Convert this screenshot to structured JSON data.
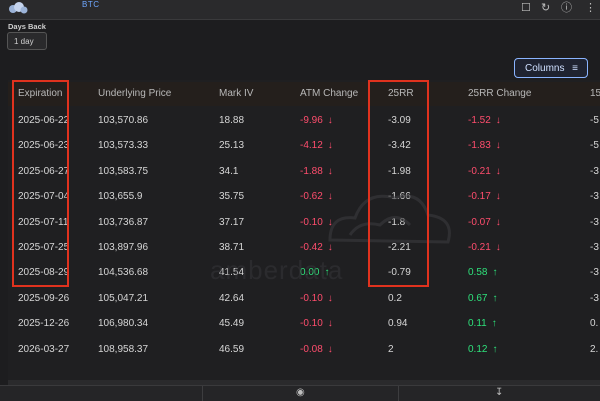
{
  "topbar": {
    "ticker": "BTC",
    "icons": [
      "bookmark-icon",
      "refresh-icon",
      "info-icon",
      "more-icon"
    ]
  },
  "filters": {
    "days_back_label": "Days Back",
    "days_back_value": "1 day"
  },
  "toolbar": {
    "columns_label": "Columns"
  },
  "table": {
    "headers": [
      "Expiration",
      "Underlying Price",
      "Mark IV",
      "ATM Change",
      "25RR",
      "25RR Change",
      "15"
    ],
    "rows": [
      {
        "expiration": "2025-06-22",
        "price": "103,570.86",
        "iv": "18.88",
        "atm": "-9.96",
        "atm_dir": "down",
        "rr": "-3.09",
        "rr_change": "-1.52",
        "rr_dir": "down",
        "c15": "-5"
      },
      {
        "expiration": "2025-06-23",
        "price": "103,573.33",
        "iv": "25.13",
        "atm": "-4.12",
        "atm_dir": "down",
        "rr": "-3.42",
        "rr_change": "-1.83",
        "rr_dir": "down",
        "c15": "-5"
      },
      {
        "expiration": "2025-06-27",
        "price": "103,583.75",
        "iv": "34.1",
        "atm": "-1.88",
        "atm_dir": "down",
        "rr": "-1.98",
        "rr_change": "-0.21",
        "rr_dir": "down",
        "c15": "-3"
      },
      {
        "expiration": "2025-07-04",
        "price": "103,655.9",
        "iv": "35.75",
        "atm": "-0.62",
        "atm_dir": "down",
        "rr": "-1.66",
        "rr_change": "-0.17",
        "rr_dir": "down",
        "c15": "-3"
      },
      {
        "expiration": "2025-07-11",
        "price": "103,736.87",
        "iv": "37.17",
        "atm": "-0.10",
        "atm_dir": "down",
        "rr": "-1.8",
        "rr_change": "-0.07",
        "rr_dir": "down",
        "c15": "-3"
      },
      {
        "expiration": "2025-07-25",
        "price": "103,897.96",
        "iv": "38.71",
        "atm": "-0.42",
        "atm_dir": "down",
        "rr": "-2.21",
        "rr_change": "-0.21",
        "rr_dir": "down",
        "c15": "-3"
      },
      {
        "expiration": "2025-08-29",
        "price": "104,536.68",
        "iv": "41.54",
        "atm": "0.00",
        "atm_dir": "up",
        "rr": "-0.79",
        "rr_change": "0.58",
        "rr_dir": "up",
        "c15": "-3"
      },
      {
        "expiration": "2025-09-26",
        "price": "105,047.21",
        "iv": "42.64",
        "atm": "-0.10",
        "atm_dir": "down",
        "rr": "0.2",
        "rr_change": "0.67",
        "rr_dir": "up",
        "c15": "-3"
      },
      {
        "expiration": "2025-12-26",
        "price": "106,980.34",
        "iv": "45.49",
        "atm": "-0.10",
        "atm_dir": "down",
        "rr": "0.94",
        "rr_change": "0.11",
        "rr_dir": "up",
        "c15": "0."
      },
      {
        "expiration": "2026-03-27",
        "price": "108,958.37",
        "iv": "46.59",
        "atm": "-0.08",
        "atm_dir": "down",
        "rr": "2",
        "rr_change": "0.12",
        "rr_dir": "up",
        "c15": "2."
      }
    ]
  },
  "watermark": "amberdata",
  "colors": {
    "negative": "#ff4d6d",
    "positive": "#2ee07a",
    "highlight": "#e0321e",
    "accent": "#8ab4ff"
  },
  "bottombar": {
    "icons": [
      "camera-icon",
      "download-icon"
    ]
  }
}
